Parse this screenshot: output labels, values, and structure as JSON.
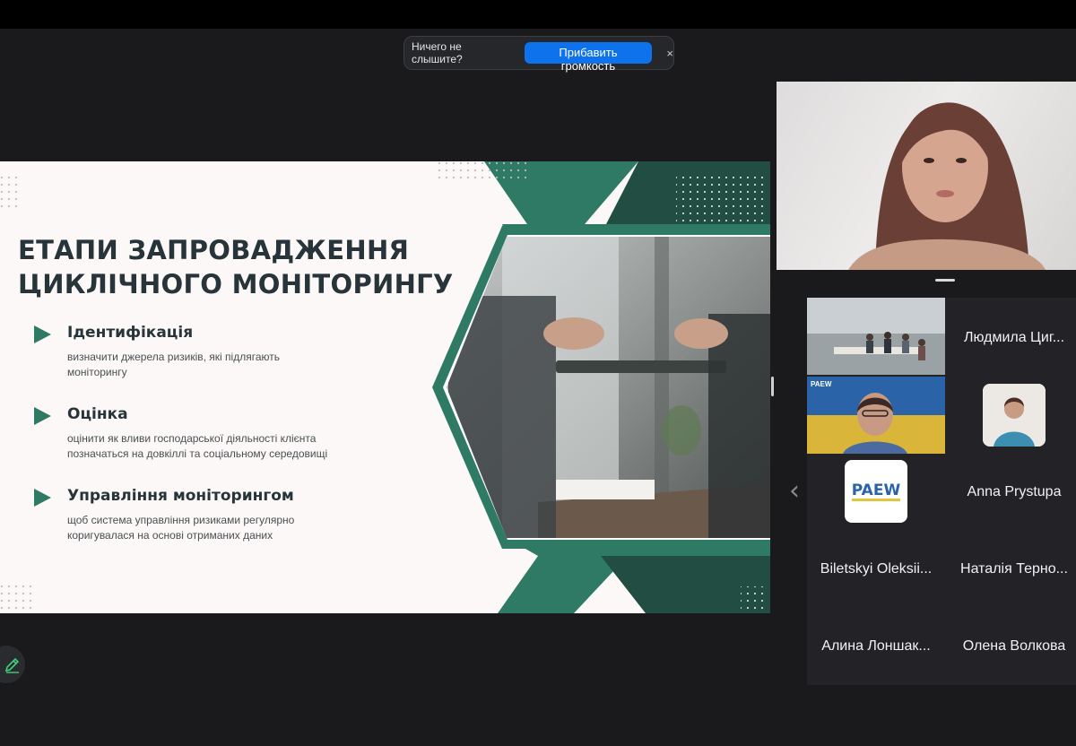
{
  "notice": {
    "text": "Ничего не слышите?",
    "action_label": "Прибавить громкость",
    "close_glyph": "×"
  },
  "slide": {
    "title_line1": "ЕТАПИ ЗАПРОВАДЖЕННЯ",
    "title_line2": "ЦИКЛІЧНОГО МОНІТОРИНГУ",
    "steps": [
      {
        "title": "Ідентифікація",
        "desc_line1": "визначити джерела ризиків, які підлягають",
        "desc_line2": "моніторингу"
      },
      {
        "title": "Оцінка",
        "desc_line1": "оцінити як вливи господарської діяльності клієнта",
        "desc_line2": "позначаться на довкіллі та соціальному середовищі"
      },
      {
        "title": "Управління моніторингом",
        "desc_line1": "щоб система управління ризиками регулярно",
        "desc_line2": "коригувалася на основі отриманих даних"
      }
    ],
    "colors": {
      "accent": "#2f7a64",
      "dark_green": "#224d43",
      "title": "#27353a"
    }
  },
  "gallery": {
    "participants": [
      {
        "name": "Людмила Циг..."
      },
      {
        "name": "Anna Prystupa"
      },
      {
        "name": "Biletskyi Oleksii..."
      },
      {
        "name": "Наталія Терно..."
      },
      {
        "name": "Алина Лоншак..."
      },
      {
        "name": "Олена Волкова"
      }
    ],
    "logo_text": "PAEW",
    "banner_text": "PAEW",
    "prev_glyph": "‹"
  },
  "icons": {
    "annotate": "pencil-icon",
    "prev": "chevron-left-icon",
    "close": "close-icon"
  }
}
